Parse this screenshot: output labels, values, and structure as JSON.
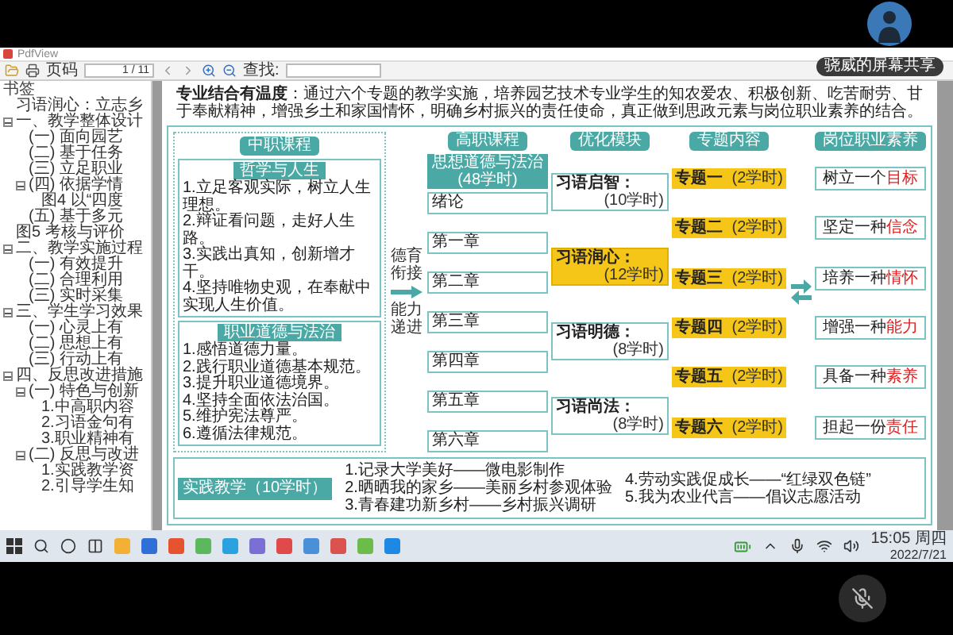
{
  "screen_share": {
    "label": "骁威的屏幕共享"
  },
  "window": {
    "title": "PdfView"
  },
  "toolbar": {
    "page_label": "页码",
    "page_value": "1",
    "page_total": "/ 11",
    "find_label": "查找:"
  },
  "bookmarks": {
    "title": "书签",
    "items": [
      {
        "label": "习语润心：立志乡"
      },
      {
        "label": "一、教学整体设计",
        "children": [
          {
            "label": "(一) 面向园艺"
          },
          {
            "label": "(二) 基于任务"
          },
          {
            "label": "(三) 立足职业"
          },
          {
            "label": "(四) 依据学情",
            "children": [
              {
                "label": "图4 以“四度"
              }
            ]
          },
          {
            "label": "(五) 基于多元"
          }
        ]
      },
      {
        "label": "图5 考核与评价"
      },
      {
        "label": "二、教学实施过程",
        "children": [
          {
            "label": "(一) 有效提升"
          },
          {
            "label": "(二) 合理利用"
          },
          {
            "label": "(三) 实时采集"
          }
        ]
      },
      {
        "label": "三、学生学习效果",
        "children": [
          {
            "label": "(一) 心灵上有"
          },
          {
            "label": "(二) 思想上有"
          },
          {
            "label": "(三) 行动上有"
          }
        ]
      },
      {
        "label": "四、反思改进措施",
        "children": [
          {
            "label": "(一) 特色与创新",
            "children": [
              {
                "label": "1.中高职内容"
              },
              {
                "label": "2.习语金句有"
              },
              {
                "label": "3.职业精神有"
              }
            ]
          },
          {
            "label": "(二) 反思与改进",
            "children": [
              {
                "label": "1.实践教学资"
              },
              {
                "label": "2.引导学生知"
              }
            ]
          }
        ]
      }
    ]
  },
  "document": {
    "intro": "**专业结合有温度**：通过六个专题的教学实施，培养园艺技术专业学生的知农爱农、积极创新、吃苦耐劳、甘于奉献精神，增强乡土和家国情怀，明确乡村振兴的责任使命，真正做到思政元素与岗位职业素养的结合。",
    "diagram": {
      "secondary": {
        "heading": "中职课程",
        "courses": [
          {
            "title": "哲学与人生",
            "points": [
              "1.立足客观实际，树立人生理想。",
              "2.辩证看问题，走好人生路。",
              "3.实践出真知，创新增才干。",
              "4.坚持唯物史观，在奉献中实现人生价值。"
            ]
          },
          {
            "title": "职业道德与法治",
            "points": [
              "1.感悟道德力量。",
              "2.践行职业道德基本规范。",
              "3.提升职业道德境界。",
              "4.坚持全面依法治国。",
              "5.维护宪法尊严。",
              "6.遵循法律规范。"
            ]
          }
        ]
      },
      "link_labels": [
        "德育衔接",
        "能力递进"
      ],
      "higher": {
        "heading": "高职课程",
        "course": "思想道德与法治",
        "hours": "(48学时)",
        "chapters": [
          "绪论",
          "第一章",
          "第二章",
          "第三章",
          "第四章",
          "第五章",
          "第六章"
        ]
      },
      "modules": {
        "heading": "优化模块",
        "items": [
          {
            "name": "习语启智：",
            "hours": "(10学时)",
            "highlighted": false
          },
          {
            "name": "习语润心：",
            "hours": "(12学时)",
            "highlighted": true
          },
          {
            "name": "习语明德：",
            "hours": "(8学时)",
            "highlighted": false
          },
          {
            "name": "习语尚法：",
            "hours": "(8学时)",
            "highlighted": false
          }
        ]
      },
      "topics": {
        "heading": "专题内容",
        "items": [
          {
            "name": "专题一",
            "hours": "(2学时)"
          },
          {
            "name": "专题二",
            "hours": "(2学时)"
          },
          {
            "name": "专题三",
            "hours": "(2学时)"
          },
          {
            "name": "专题四",
            "hours": "(2学时)"
          },
          {
            "name": "专题五",
            "hours": "(2学时)"
          },
          {
            "name": "专题六",
            "hours": "(2学时)"
          }
        ]
      },
      "literacy": {
        "heading": "岗位职业素养",
        "items": [
          {
            "text": "树立一个",
            "key": "目标"
          },
          {
            "text": "坚定一种",
            "key": "信念"
          },
          {
            "text": "培养一种",
            "key": "情怀"
          },
          {
            "text": "增强一种",
            "key": "能力"
          },
          {
            "text": "具备一种",
            "key": "素养"
          },
          {
            "text": "担起一份",
            "key": "责任"
          }
        ]
      },
      "practice": {
        "title": "实践教学（10学时）",
        "items": [
          "1.记录大学美好——微电影制作",
          "2.晒晒我的家乡——美丽乡村参观体验",
          "3.青春建功新乡村——乡村振兴调研",
          "4.劳动实践促成长——“红绿双色链”",
          "5.我为农业代言——倡议志愿活动"
        ]
      }
    }
  },
  "taskbar": {
    "time": "15:05 周四",
    "date": "2022/7/21"
  }
}
